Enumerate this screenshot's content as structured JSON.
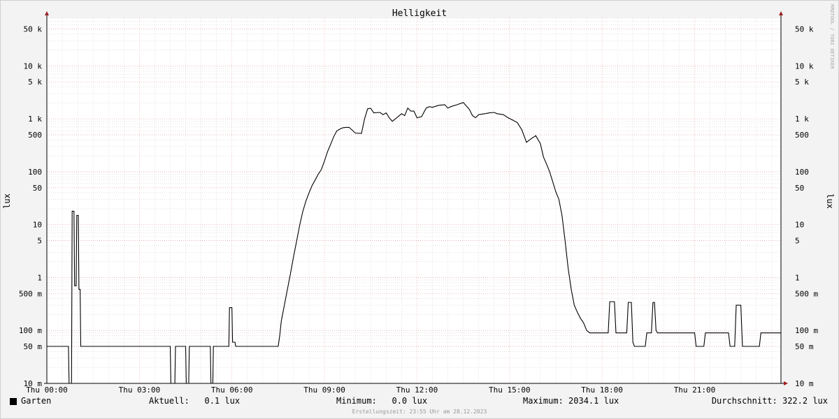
{
  "chart_data": {
    "type": "line",
    "title": "Helligkeit",
    "ylabel": "lux",
    "yscale": "log",
    "ylim": [
      0.01,
      80000
    ],
    "x_ticks": [
      "Thu 00:00",
      "Thu 03:00",
      "Thu 06:00",
      "Thu 09:00",
      "Thu 12:00",
      "Thu 15:00",
      "Thu 18:00",
      "Thu 21:00"
    ],
    "y_ticks": [
      {
        "value": 50000,
        "label": "50 k"
      },
      {
        "value": 10000,
        "label": "10 k"
      },
      {
        "value": 5000,
        "label": "5 k"
      },
      {
        "value": 1000,
        "label": "1 k"
      },
      {
        "value": 500,
        "label": "500"
      },
      {
        "value": 100,
        "label": "100"
      },
      {
        "value": 50,
        "label": "50"
      },
      {
        "value": 10,
        "label": "10"
      },
      {
        "value": 5,
        "label": "5"
      },
      {
        "value": 1,
        "label": "1"
      },
      {
        "value": 0.5,
        "label": "500 m"
      },
      {
        "value": 0.1,
        "label": "100 m"
      },
      {
        "value": 0.05,
        "label": "50 m"
      },
      {
        "value": 0.01,
        "label": "10 m"
      }
    ],
    "grid": true,
    "series": [
      {
        "name": "Garten",
        "color": "#000000",
        "points": [
          [
            0.0,
            0.05
          ],
          [
            0.7,
            0.05
          ],
          [
            0.72,
            0.0
          ],
          [
            0.8,
            0.0
          ],
          [
            0.82,
            18
          ],
          [
            0.88,
            18
          ],
          [
            0.9,
            0.7
          ],
          [
            0.95,
            0.7
          ],
          [
            0.97,
            15
          ],
          [
            1.02,
            15
          ],
          [
            1.04,
            0.6
          ],
          [
            1.08,
            0.6
          ],
          [
            1.1,
            0.05
          ],
          [
            4.0,
            0.05
          ],
          [
            4.02,
            0.0
          ],
          [
            4.15,
            0.0
          ],
          [
            4.17,
            0.05
          ],
          [
            4.5,
            0.05
          ],
          [
            4.52,
            0.0
          ],
          [
            4.6,
            0.0
          ],
          [
            4.62,
            0.05
          ],
          [
            5.3,
            0.05
          ],
          [
            5.32,
            0.0
          ],
          [
            5.38,
            0.0
          ],
          [
            5.4,
            0.05
          ],
          [
            5.9,
            0.05
          ],
          [
            5.92,
            0.27
          ],
          [
            6.0,
            0.27
          ],
          [
            6.02,
            0.06
          ],
          [
            6.1,
            0.06
          ],
          [
            6.12,
            0.05
          ],
          [
            7.5,
            0.05
          ],
          [
            7.55,
            0.08
          ],
          [
            7.6,
            0.15
          ],
          [
            7.7,
            0.3
          ],
          [
            7.8,
            0.6
          ],
          [
            7.9,
            1.2
          ],
          [
            8.0,
            2.5
          ],
          [
            8.1,
            5
          ],
          [
            8.2,
            10
          ],
          [
            8.3,
            18
          ],
          [
            8.4,
            28
          ],
          [
            8.5,
            40
          ],
          [
            8.6,
            55
          ],
          [
            8.7,
            70
          ],
          [
            8.8,
            90
          ],
          [
            8.9,
            110
          ],
          [
            9.0,
            160
          ],
          [
            9.1,
            240
          ],
          [
            9.2,
            330
          ],
          [
            9.3,
            460
          ],
          [
            9.4,
            590
          ],
          [
            9.5,
            640
          ],
          [
            9.6,
            680
          ],
          [
            9.7,
            690
          ],
          [
            9.8,
            690
          ],
          [
            10.0,
            540
          ],
          [
            10.2,
            530
          ],
          [
            10.3,
            1000
          ],
          [
            10.4,
            1550
          ],
          [
            10.5,
            1580
          ],
          [
            10.6,
            1300
          ],
          [
            10.8,
            1320
          ],
          [
            10.9,
            1200
          ],
          [
            11.0,
            1300
          ],
          [
            11.1,
            1050
          ],
          [
            11.2,
            900
          ],
          [
            11.3,
            1000
          ],
          [
            11.5,
            1250
          ],
          [
            11.6,
            1150
          ],
          [
            11.7,
            1600
          ],
          [
            11.8,
            1400
          ],
          [
            11.9,
            1400
          ],
          [
            12.0,
            1050
          ],
          [
            12.15,
            1100
          ],
          [
            12.3,
            1600
          ],
          [
            12.4,
            1700
          ],
          [
            12.5,
            1650
          ],
          [
            12.7,
            1800
          ],
          [
            12.9,
            1850
          ],
          [
            13.0,
            1600
          ],
          [
            13.1,
            1700
          ],
          [
            13.3,
            1850
          ],
          [
            13.5,
            2034
          ],
          [
            13.6,
            1750
          ],
          [
            13.7,
            1500
          ],
          [
            13.8,
            1150
          ],
          [
            13.9,
            1050
          ],
          [
            14.0,
            1200
          ],
          [
            14.2,
            1250
          ],
          [
            14.35,
            1300
          ],
          [
            14.5,
            1320
          ],
          [
            14.6,
            1250
          ],
          [
            14.8,
            1200
          ],
          [
            14.95,
            1050
          ],
          [
            15.1,
            950
          ],
          [
            15.25,
            850
          ],
          [
            15.4,
            620
          ],
          [
            15.55,
            360
          ],
          [
            15.7,
            420
          ],
          [
            15.85,
            480
          ],
          [
            16.0,
            340
          ],
          [
            16.1,
            190
          ],
          [
            16.2,
            140
          ],
          [
            16.3,
            100
          ],
          [
            16.4,
            65
          ],
          [
            16.5,
            42
          ],
          [
            16.6,
            30
          ],
          [
            16.7,
            15
          ],
          [
            16.8,
            5
          ],
          [
            16.9,
            1.5
          ],
          [
            17.0,
            0.6
          ],
          [
            17.1,
            0.3
          ],
          [
            17.2,
            0.22
          ],
          [
            17.3,
            0.17
          ],
          [
            17.4,
            0.14
          ],
          [
            17.5,
            0.1
          ],
          [
            17.6,
            0.09
          ],
          [
            18.2,
            0.09
          ],
          [
            18.25,
            0.35
          ],
          [
            18.4,
            0.35
          ],
          [
            18.45,
            0.09
          ],
          [
            18.8,
            0.09
          ],
          [
            18.85,
            0.34
          ],
          [
            18.95,
            0.34
          ],
          [
            19.0,
            0.06
          ],
          [
            19.05,
            0.05
          ],
          [
            19.4,
            0.05
          ],
          [
            19.45,
            0.09
          ],
          [
            19.6,
            0.09
          ],
          [
            19.65,
            0.34
          ],
          [
            19.7,
            0.34
          ],
          [
            19.75,
            0.1
          ],
          [
            19.8,
            0.09
          ],
          [
            21.0,
            0.09
          ],
          [
            21.05,
            0.05
          ],
          [
            21.3,
            0.05
          ],
          [
            21.35,
            0.09
          ],
          [
            22.1,
            0.09
          ],
          [
            22.15,
            0.05
          ],
          [
            22.3,
            0.05
          ],
          [
            22.35,
            0.3
          ],
          [
            22.5,
            0.3
          ],
          [
            22.55,
            0.05
          ],
          [
            23.1,
            0.05
          ],
          [
            23.15,
            0.09
          ],
          [
            23.8,
            0.09
          ]
        ]
      }
    ]
  },
  "legend": {
    "series_name": "Garten",
    "current": "Aktuell:   0.1 lux",
    "minimum": "Minimum:   0.0 lux",
    "maximum": "Maximum: 2034.1 lux",
    "average": "Durchschnitt: 322.2 lux"
  },
  "side_label": "RRDTOOL / TOBI OETIKER",
  "footer": "Erstellungszeit: 23:55 Uhr am 28.12.2023",
  "colors": {
    "background": "#f3f3f3",
    "plot_background": "#ffffff",
    "major_grid": "#e8a0a0",
    "minor_grid": "#d0d0d0",
    "axis_arrow": "#a02020",
    "line": "#000000"
  }
}
